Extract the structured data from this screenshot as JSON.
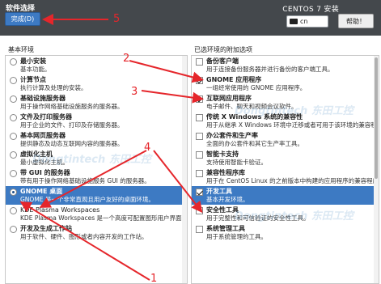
{
  "header": {
    "title": "软件选择",
    "done_label": "完成(D)",
    "os_title": "CENTOS 7 安装",
    "keyboard_lang": "cn",
    "help_label": "帮助！"
  },
  "left_title": "基本环境",
  "right_title": "已选环境的附加选项",
  "environments": [
    {
      "name": "最小安装",
      "desc": "基本功能。",
      "selected": false
    },
    {
      "name": "计算节点",
      "desc": "执行计算及处理的安装。",
      "selected": false
    },
    {
      "name": "基础设施服务器",
      "desc": "用于操作网络基础设施服务的服务器。",
      "selected": false
    },
    {
      "name": "文件及打印服务器",
      "desc": "用于企业的文件、打印及存储服务器。",
      "selected": false
    },
    {
      "name": "基本网页服务器",
      "desc": "提供静态及动态互联网内容的服务器。",
      "selected": false
    },
    {
      "name": "虚拟化主机",
      "desc": "最小虚拟化主机。",
      "selected": false
    },
    {
      "name": "带 GUI 的服务器",
      "desc": "带有用于操作网络基础设施服务 GUI 的服务器。",
      "selected": false
    },
    {
      "name": "GNOME 桌面",
      "desc": "GNOME 是一个非常直观且用户友好的桌面环境。",
      "selected": true
    },
    {
      "name": "KDE Plasma Workspaces",
      "desc": "KDE Plasma Workspaces 是一个高度可配置图形用户界面，其中包括面板、桌面、系统图标以及桌面向导和很多功能强大的 KDE 应用程序。",
      "selected": false,
      "plain": true
    },
    {
      "name": "开发及生成工作站",
      "desc": "用于软件、硬件、图形或者内容开发的工作站。",
      "selected": false
    }
  ],
  "addons": [
    {
      "name": "备份客户端",
      "desc": "用于连接备份服务器并进行备份的客户端工具。",
      "checked": false
    },
    {
      "name": "GNOME 应用程序",
      "desc": "一组经常使用的 GNOME 应用程序。",
      "checked": true
    },
    {
      "name": "互联网应用程序",
      "desc": "电子邮件、聊天和视频会议软件。",
      "checked": true
    },
    {
      "name": "传统 X Windows 系统的兼容性",
      "desc": "用于从继承 X Windows 环境中迁移或者可用于该环境的兼容程序。",
      "checked": false
    },
    {
      "name": "办公套件和生产率",
      "desc": "全面的办公套件和其它生产率工具。",
      "checked": false
    },
    {
      "name": "智能卡支持",
      "desc": "支持使用智能卡验证。",
      "checked": false
    },
    {
      "name": "兼容性程序库",
      "desc": "用于在 CentOS Linux 的之前版本中构建的应用程序的兼容程序库。",
      "checked": false
    },
    {
      "name": "开发工具",
      "desc": "基本开发环境。",
      "checked": true,
      "highlight": true
    },
    {
      "name": "安全性工具",
      "desc": "用于完整性和可信验证的安全性工具。",
      "checked": false
    },
    {
      "name": "系统管理工具",
      "desc": "用于系统管理的工具。",
      "checked": false
    }
  ],
  "annotations": [
    "1",
    "2",
    "3",
    "4",
    "5"
  ],
  "watermark": "Dongtintech 东田工控",
  "colors": {
    "header_bg": "#44484c",
    "accent": "#3d7ac3",
    "arrow": "#e5262b"
  }
}
